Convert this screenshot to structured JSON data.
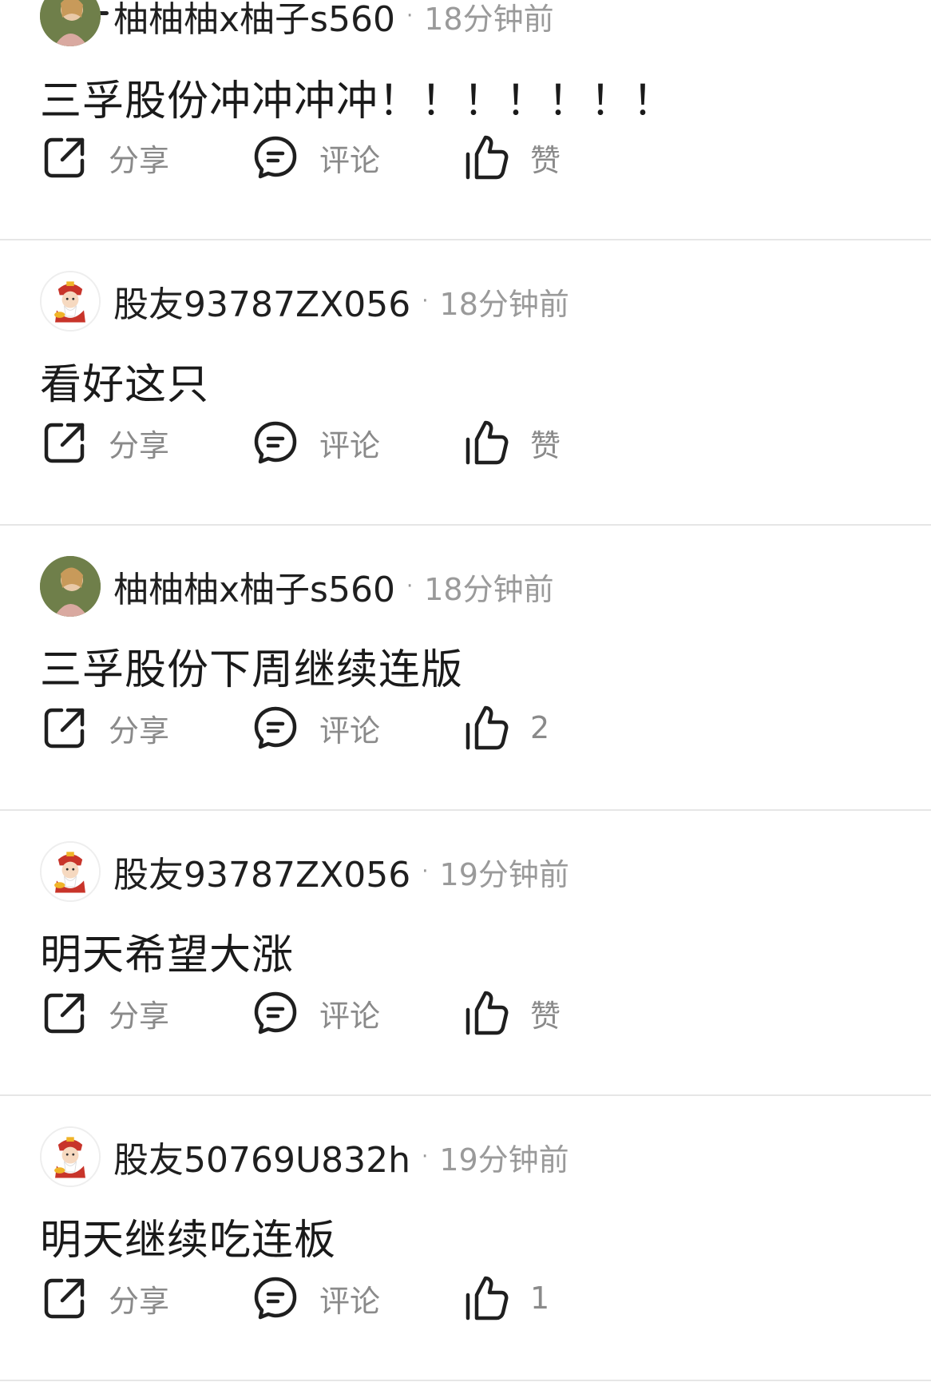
{
  "actions": {
    "share_label": "分享",
    "comment_label": "评论",
    "like_default_label": "赞"
  },
  "posts": [
    {
      "username": "柚柚柚x柚子s560",
      "time": "18分钟前",
      "content": "三孚股份冲冲冲冲！！！！！！！",
      "avatar": "photo-avatar",
      "like_label": "赞"
    },
    {
      "username": "股友93787ZX056",
      "time": "18分钟前",
      "content": "看好这只",
      "avatar": "fortune-god-avatar",
      "like_label": "赞"
    },
    {
      "username": "柚柚柚x柚子s560",
      "time": "18分钟前",
      "content": "三孚股份下周继续连版",
      "avatar": "photo-avatar",
      "like_label": "2"
    },
    {
      "username": "股友93787ZX056",
      "time": "19分钟前",
      "content": "明天希望大涨",
      "avatar": "fortune-god-avatar",
      "like_label": "赞"
    },
    {
      "username": "股友50769U832h",
      "time": "19分钟前",
      "content": "明天继续吃连板",
      "avatar": "fortune-god-avatar",
      "like_label": "1"
    }
  ],
  "separator": "·",
  "colors": {
    "text_primary": "#1a1a1a",
    "text_secondary": "#9a9a9a",
    "icon": "#1f1f1f",
    "divider": "#e6e6e6"
  }
}
